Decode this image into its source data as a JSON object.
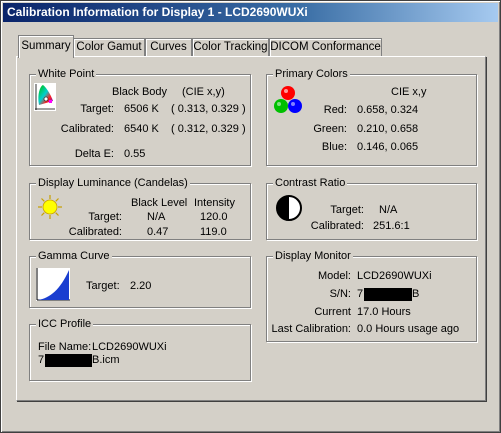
{
  "window": {
    "title": "Calibration Information for Display 1 - LCD2690WUXi"
  },
  "tabs": [
    "Summary",
    "Color Gamut",
    "Curves",
    "Color Tracking",
    "DICOM Conformance"
  ],
  "white_point": {
    "title": "White Point",
    "header_black_body": "Black Body",
    "header_cie": "(CIE x,y)",
    "target_label": "Target:",
    "target_kelvin": "6506 K",
    "target_cie": "( 0.313, 0.329 )",
    "calibrated_label": "Calibrated:",
    "calibrated_kelvin": "6540 K",
    "calibrated_cie": "( 0.312, 0.329 )",
    "delta_label": "Delta E:",
    "delta_value": "0.55"
  },
  "primary_colors": {
    "title": "Primary Colors",
    "header": "CIE x,y",
    "rows": [
      {
        "label": "Red:",
        "value": "0.658, 0.324"
      },
      {
        "label": "Green:",
        "value": "0.210, 0.658"
      },
      {
        "label": "Blue:",
        "value": "0.146, 0.065"
      }
    ]
  },
  "luminance": {
    "title": "Display Luminance (Candelas)",
    "header_black": "Black Level",
    "header_intensity": "Intensity",
    "target_label": "Target:",
    "target_black": "N/A",
    "target_intensity": "120.0",
    "calibrated_label": "Calibrated:",
    "calibrated_black": "0.47",
    "calibrated_intensity": "119.0"
  },
  "contrast": {
    "title": "Contrast Ratio",
    "target_label": "Target:",
    "target_value": "N/A",
    "calibrated_label": "Calibrated:",
    "calibrated_value": "251.6:1"
  },
  "gamma": {
    "title": "Gamma Curve",
    "target_label": "Target:",
    "target_value": "2.20"
  },
  "monitor": {
    "title": "Display Monitor",
    "model_label": "Model:",
    "model_value": "LCD2690WUXi",
    "sn_label": "S/N:",
    "sn_prefix": "7",
    "sn_suffix": "B",
    "current_label": "Current",
    "current_value": "17.0 Hours",
    "last_label": "Last Calibration:",
    "last_value": "0.0 Hours usage ago"
  },
  "icc": {
    "title": "ICC Profile",
    "file_label": "File Name:",
    "file_value": "LCD2690WUXi",
    "path_prefix": "7",
    "path_suffix": "B.icm"
  }
}
